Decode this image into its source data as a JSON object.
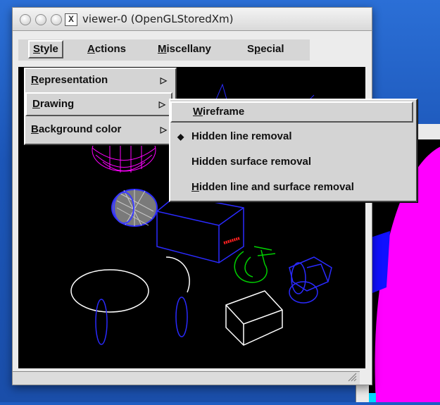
{
  "window": {
    "title": "viewer-0 (OpenGLStoredXm)",
    "x_icon": "X"
  },
  "menubar": {
    "items": [
      {
        "label": "Style",
        "mnemonic": "S",
        "rest": "tyle"
      },
      {
        "label": "Actions",
        "mnemonic": "A",
        "rest": "ctions"
      },
      {
        "label": "Miscellany",
        "mnemonic": "M",
        "rest": "iscellany"
      },
      {
        "label": "Special",
        "pre": "S",
        "mnemonic": "p",
        "rest": "ecial"
      }
    ]
  },
  "style_menu": {
    "items": [
      {
        "label": "Representation",
        "mnemonic": "R",
        "rest": "epresentation",
        "arrow": "▷"
      },
      {
        "label": "Drawing",
        "mnemonic": "D",
        "rest": "rawing",
        "arrow": "▷"
      },
      {
        "label": "Background color",
        "mnemonic": "B",
        "rest": "ackground color",
        "arrow": "▷"
      }
    ]
  },
  "drawing_submenu": {
    "items": [
      {
        "label": "Wireframe",
        "mnemonic": "W",
        "rest": "ireframe",
        "checked": false
      },
      {
        "label": "Hidden line removal",
        "checked": true,
        "check_glyph": "◆"
      },
      {
        "label": "Hidden surface removal",
        "checked": false
      },
      {
        "label": "Hidden line and surface removal",
        "mnemonic": "H",
        "rest": "idden line and surface removal",
        "checked": false
      }
    ]
  },
  "colors": {
    "desktop": "#1f5dc2",
    "menu_bg": "#d4d4d4",
    "canvas": "#000000",
    "magenta": "#ff00ff",
    "blue": "#1a1aff",
    "green": "#00cc00",
    "red": "#ff2020",
    "white": "#ffffff"
  }
}
